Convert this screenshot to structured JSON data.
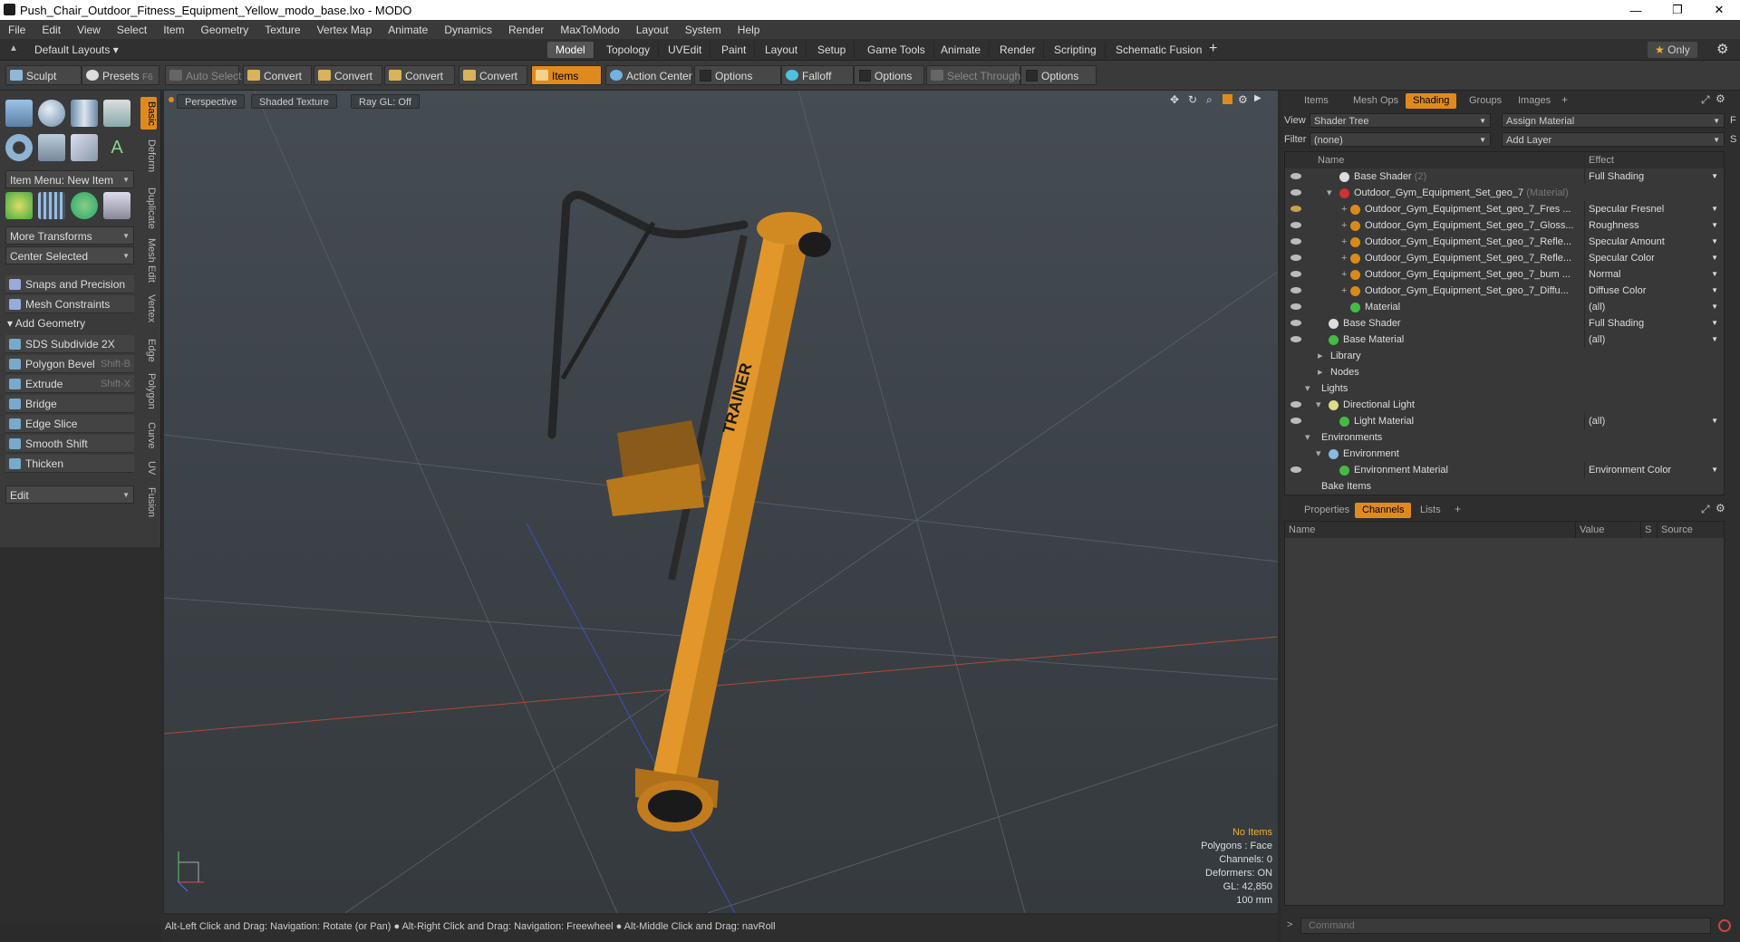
{
  "window": {
    "title": "Push_Chair_Outdoor_Fitness_Equipment_Yellow_modo_base.lxo - MODO",
    "minimize": "—",
    "maximize": "❐",
    "close": "✕"
  },
  "menu": [
    "File",
    "Edit",
    "View",
    "Select",
    "Item",
    "Geometry",
    "Texture",
    "Vertex Map",
    "Animate",
    "Dynamics",
    "Render",
    "MaxToModo",
    "Layout",
    "System",
    "Help"
  ],
  "layouts": {
    "label": "Default Layouts",
    "only": "Only"
  },
  "tabs": [
    "Model",
    "Topology",
    "UVEdit",
    "Paint",
    "Layout",
    "Setup",
    "Game Tools",
    "Animate",
    "Render",
    "Scripting",
    "Schematic Fusion"
  ],
  "toolbar": {
    "sculpt": "Sculpt",
    "presets": "Presets",
    "presets_key": "F6",
    "auto_select": "Auto Select",
    "convert1": "Convert",
    "convert2": "Convert",
    "convert3": "Convert",
    "convert4": "Convert",
    "items": "Items",
    "action_center": "Action Center",
    "options1": "Options",
    "falloff": "Falloff",
    "options2": "Options",
    "select_through": "Select Through",
    "options3": "Options"
  },
  "left": {
    "item_menu": "Item Menu: New Item",
    "more_transforms": "More Transforms",
    "center_selected": "Center Selected",
    "snaps": "Snaps and Precision",
    "mesh_constraints": "Mesh Constraints",
    "add_geometry": "Add Geometry",
    "sds": "SDS Subdivide 2X",
    "polygon_bevel": "Polygon Bevel",
    "polygon_bevel_key": "Shift-B",
    "extrude": "Extrude",
    "extrude_key": "Shift-X",
    "bridge": "Bridge",
    "edge_slice": "Edge Slice",
    "smooth_shift": "Smooth Shift",
    "thicken": "Thicken",
    "edit": "Edit"
  },
  "vtabs": [
    "Basic",
    "Deform",
    "Duplicate",
    "Mesh Edit",
    "Vertex",
    "Edge",
    "Polygon",
    "Curve",
    "UV",
    "Fusion"
  ],
  "viewport": {
    "perspective": "Perspective",
    "shaded": "Shaded Texture",
    "raygl": "Ray GL: Off",
    "status": {
      "no_items": "No Items",
      "polygons": "Polygons : Face",
      "channels": "Channels: 0",
      "deformers": "Deformers: ON",
      "gl": "GL: 42,850",
      "scale": "100 mm"
    },
    "model_text": "TRAINER"
  },
  "hint": "Alt-Left Click and Drag: Navigation: Rotate (or Pan) ● Alt-Right Click and Drag: Navigation: Freewheel ● Alt-Middle Click and Drag: navRoll",
  "right": {
    "tabs": [
      "Items",
      "Mesh Ops",
      "Shading",
      "Groups",
      "Images"
    ],
    "view_label": "View",
    "view_value": "Shader Tree",
    "assign": "Assign Material",
    "assign_key": "F",
    "filter_label": "Filter",
    "filter_value": "(none)",
    "add_layer": "Add Layer",
    "add_layer_key": "S",
    "col_name": "Name",
    "col_effect": "Effect",
    "rows": [
      {
        "name": "Base Shader",
        "extra": "(2)",
        "effect": "Full Shading"
      },
      {
        "name": "Outdoor_Gym_Equipment_Set_geo_7",
        "extra": "(Material)",
        "effect": ""
      },
      {
        "name": "Outdoor_Gym_Equipment_Set_geo_7_Fres ...",
        "extra": "",
        "effect": "Specular Fresnel"
      },
      {
        "name": "Outdoor_Gym_Equipment_Set_geo_7_Gloss...",
        "extra": "",
        "effect": "Roughness"
      },
      {
        "name": "Outdoor_Gym_Equipment_Set_geo_7_Refle...",
        "extra": "",
        "effect": "Specular Amount"
      },
      {
        "name": "Outdoor_Gym_Equipment_Set_geo_7_Refle...",
        "extra": "",
        "effect": "Specular Color"
      },
      {
        "name": "Outdoor_Gym_Equipment_Set_geo_7_bum ...",
        "extra": "",
        "effect": "Normal"
      },
      {
        "name": "Outdoor_Gym_Equipment_Set_geo_7_Diffu...",
        "extra": "",
        "effect": "Diffuse Color"
      },
      {
        "name": "Material",
        "extra": "",
        "effect": "(all)"
      },
      {
        "name": "Base Shader",
        "extra": "",
        "effect": "Full Shading"
      },
      {
        "name": "Base Material",
        "extra": "",
        "effect": "(all)"
      },
      {
        "name": "Library",
        "extra": "",
        "effect": ""
      },
      {
        "name": "Nodes",
        "extra": "",
        "effect": ""
      },
      {
        "name": "Lights",
        "extra": "",
        "effect": ""
      },
      {
        "name": "Directional Light",
        "extra": "",
        "effect": ""
      },
      {
        "name": "Light Material",
        "extra": "",
        "effect": "(all)"
      },
      {
        "name": "Environments",
        "extra": "",
        "effect": ""
      },
      {
        "name": "Environment",
        "extra": "",
        "effect": ""
      },
      {
        "name": "Environment Material",
        "extra": "",
        "effect": "Environment Color"
      },
      {
        "name": "Bake Items",
        "extra": "",
        "effect": ""
      }
    ],
    "lower_tabs": [
      "Properties",
      "Channels",
      "Lists"
    ],
    "ch_cols": [
      "Name",
      "Value",
      "S",
      "Source"
    ],
    "command": "Command"
  }
}
